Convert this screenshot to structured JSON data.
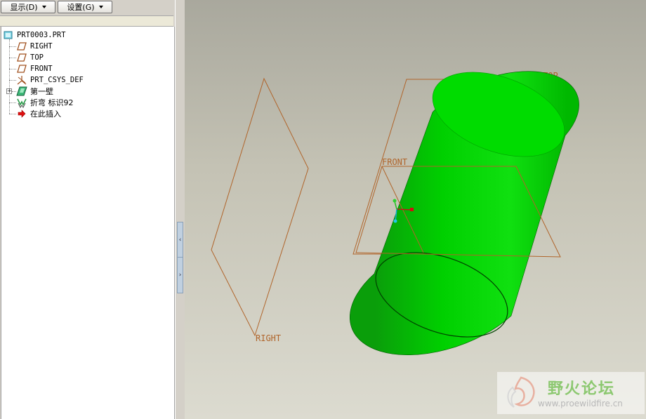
{
  "toolbar": {
    "display_menu": "显示(D)",
    "settings_menu": "设置(G)"
  },
  "model_tree": {
    "root": "PRT0003.PRT",
    "items": [
      {
        "label": "RIGHT",
        "icon": "datum-plane-icon"
      },
      {
        "label": "TOP",
        "icon": "datum-plane-icon"
      },
      {
        "label": "FRONT",
        "icon": "datum-plane-icon"
      },
      {
        "label": "PRT_CSYS_DEF",
        "icon": "coordinate-system-icon"
      },
      {
        "label": "第一壁",
        "icon": "first-wall-icon"
      },
      {
        "label": "折弯 标识92",
        "icon": "bend-icon"
      },
      {
        "label": "在此插入",
        "icon": "insert-here-arrow-icon"
      }
    ]
  },
  "viewport": {
    "datum_labels": {
      "top": "TOP",
      "front": "FRONT",
      "right": "RIGHT"
    },
    "colors": {
      "datum_plane": "#b0642a",
      "solid": "#00c800"
    }
  },
  "watermark": {
    "title": "野火论坛",
    "url": "www.proewildfire.cn"
  }
}
